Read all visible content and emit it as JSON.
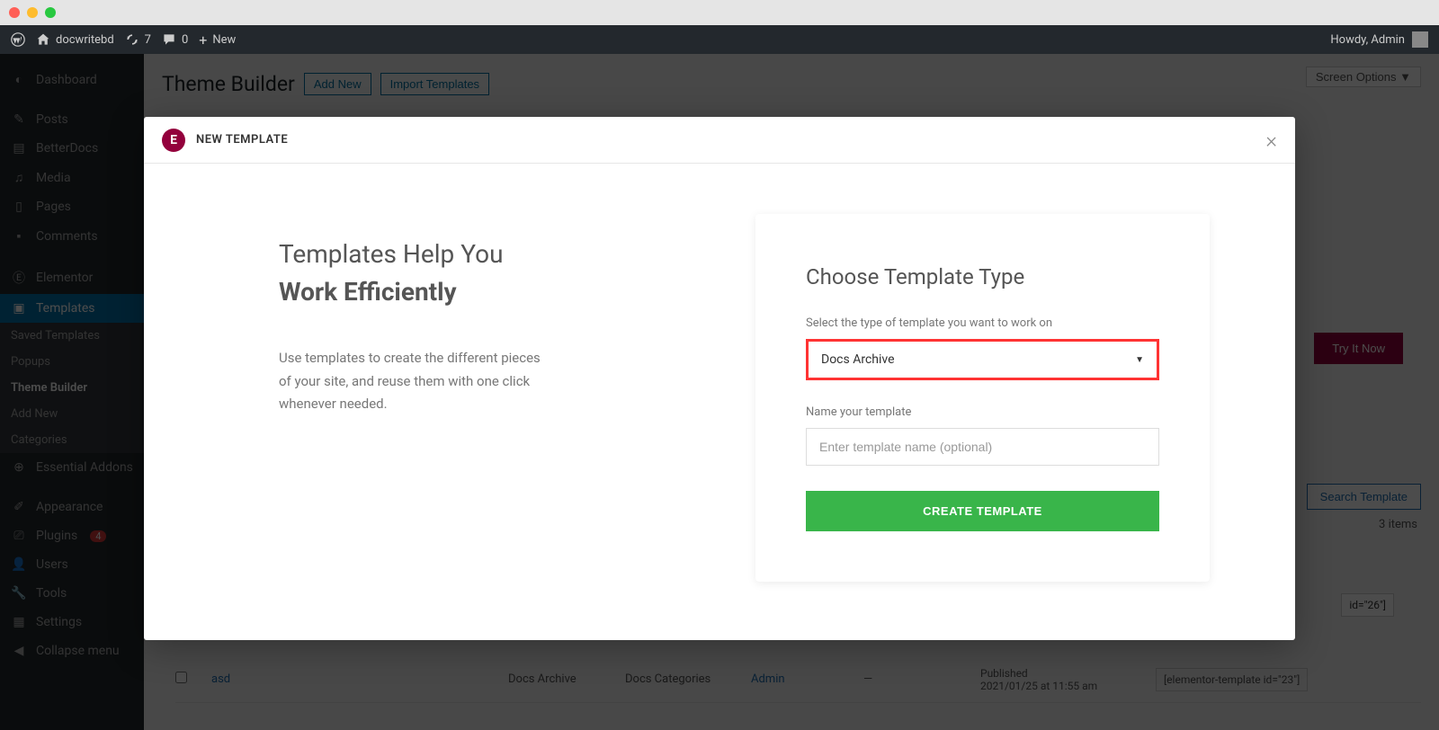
{
  "adminbar": {
    "site_name": "docwritebd",
    "updates_count": "7",
    "comments_count": "0",
    "new_label": "New",
    "howdy": "Howdy, Admin"
  },
  "sidebar": {
    "dashboard": "Dashboard",
    "posts": "Posts",
    "betterdocs": "BetterDocs",
    "media": "Media",
    "pages": "Pages",
    "comments": "Comments",
    "elementor": "Elementor",
    "templates": "Templates",
    "saved_templates": "Saved Templates",
    "popups": "Popups",
    "theme_builder": "Theme Builder",
    "add_new": "Add New",
    "categories": "Categories",
    "essential_addons": "Essential Addons",
    "appearance": "Appearance",
    "plugins": "Plugins",
    "plugins_count": "4",
    "users": "Users",
    "tools": "Tools",
    "settings": "Settings",
    "collapse": "Collapse menu"
  },
  "page": {
    "title": "Theme Builder",
    "add_new": "Add New",
    "import_templates": "Import Templates",
    "screen_options": "Screen Options",
    "try_it_now": "Try It Now",
    "search_template": "Search Template",
    "items_label": "3 items",
    "shortcode_1": "id=\"26\"]",
    "row1": {
      "title": "asd",
      "type": "Docs Archive",
      "categories": "Docs Categories",
      "author": "Admin",
      "comments": "—",
      "date_status": "Published",
      "date": "2021/01/25 at 11:55 am",
      "shortcode": "[elementor-template id=\"23\"]"
    }
  },
  "modal": {
    "header_title": "NEW TEMPLATE",
    "left_heading_1": "Templates Help You",
    "left_heading_2": "Work Efficiently",
    "left_desc": "Use templates to create the different pieces of your site, and reuse them with one click whenever needed.",
    "form_title": "Choose Template Type",
    "select_label": "Select the type of template you want to work on",
    "select_value": "Docs Archive",
    "name_label": "Name your template",
    "name_placeholder": "Enter template name (optional)",
    "create_btn": "CREATE TEMPLATE"
  }
}
